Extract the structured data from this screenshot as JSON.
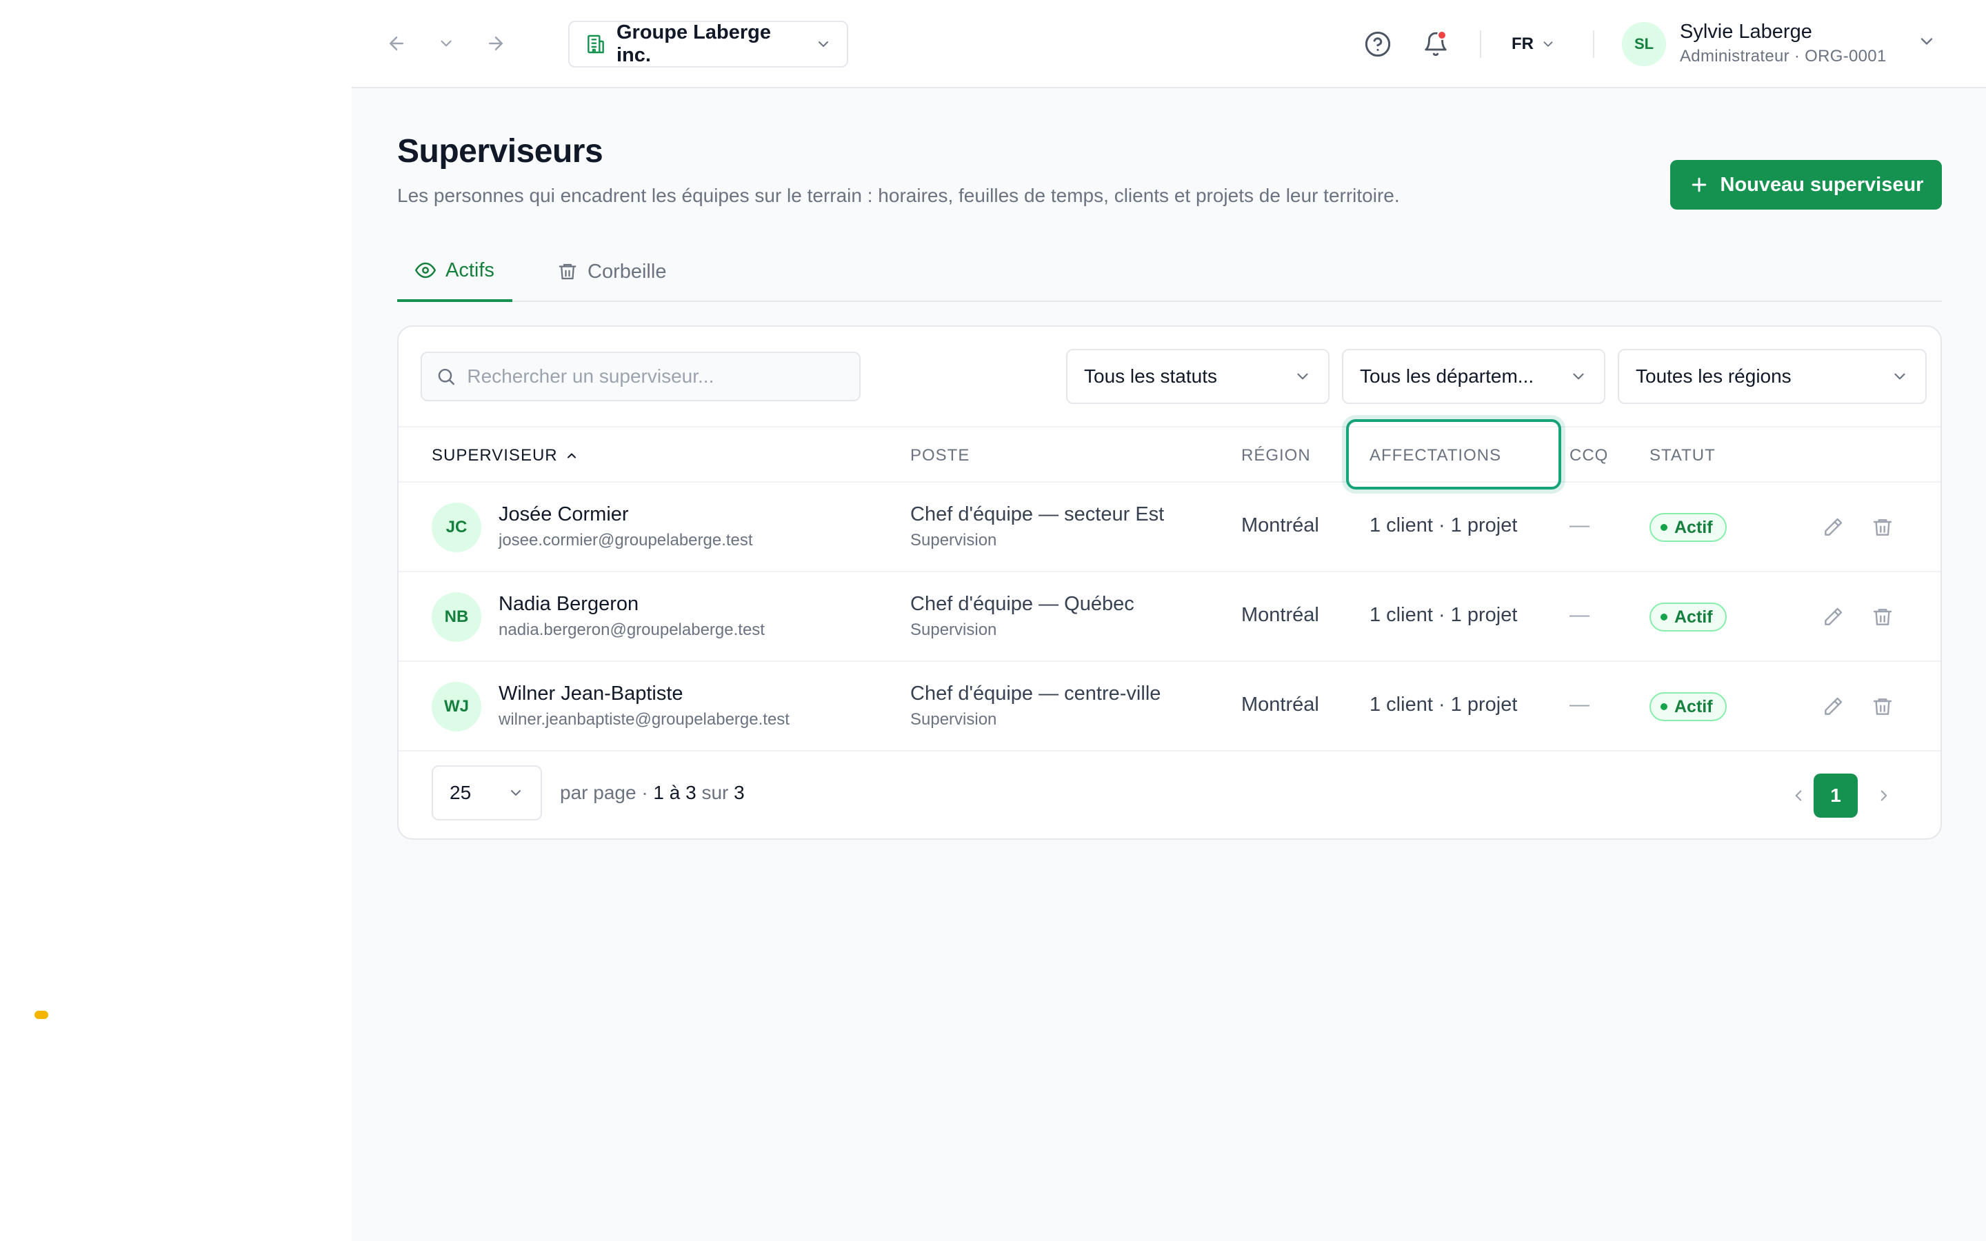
{
  "topbar": {
    "org_name": "Groupe Laberge inc.",
    "language": "FR",
    "user": {
      "initials": "SL",
      "name": "Sylvie Laberge",
      "role": "Administrateur · ORG-0001"
    }
  },
  "header": {
    "title": "Superviseurs",
    "subtitle": "Les personnes qui encadrent les équipes sur le terrain : horaires, feuilles de temps, clients et projets de leur territoire.",
    "new_button": "Nouveau superviseur"
  },
  "tabs": [
    {
      "label": "Actifs",
      "icon": "eye-icon",
      "active": true
    },
    {
      "label": "Corbeille",
      "icon": "trash-icon",
      "active": false
    }
  ],
  "filters": {
    "search_placeholder": "Rechercher un superviseur...",
    "status": "Tous les statuts",
    "department": "Tous les départem...",
    "region": "Toutes les régions"
  },
  "columns": {
    "supervisor": "SUPERVISEUR",
    "position": "POSTE",
    "region": "RÉGION",
    "assignments": "AFFECTATIONS",
    "ccq": "CCQ",
    "status": "STATUT"
  },
  "rows": [
    {
      "initials": "JC",
      "name": "Josée Cormier",
      "email": "josee.cormier@groupelaberge.test",
      "position": "Chef d'équipe — secteur Est",
      "department": "Supervision",
      "region": "Montréal",
      "assignments": "1 client · 1 projet",
      "ccq": "—",
      "status": "Actif"
    },
    {
      "initials": "NB",
      "name": "Nadia Bergeron",
      "email": "nadia.bergeron@groupelaberge.test",
      "position": "Chef d'équipe — Québec",
      "department": "Supervision",
      "region": "Montréal",
      "assignments": "1 client · 1 projet",
      "ccq": "—",
      "status": "Actif"
    },
    {
      "initials": "WJ",
      "name": "Wilner Jean-Baptiste",
      "email": "wilner.jeanbaptiste@groupelaberge.test",
      "position": "Chef d'équipe — centre-ville",
      "department": "Supervision",
      "region": "Montréal",
      "assignments": "1 client · 1 projet",
      "ccq": "—",
      "status": "Actif"
    }
  ],
  "pagination": {
    "per_page": "25",
    "per_page_label": "par page ·",
    "range": "1 à 3",
    "of_label": "sur",
    "total": "3",
    "current_page": "1"
  },
  "colors": {
    "accent": "#15924f",
    "accent_text": "#15803d",
    "highlight": "#16a37a",
    "notification": "#ef4444"
  }
}
